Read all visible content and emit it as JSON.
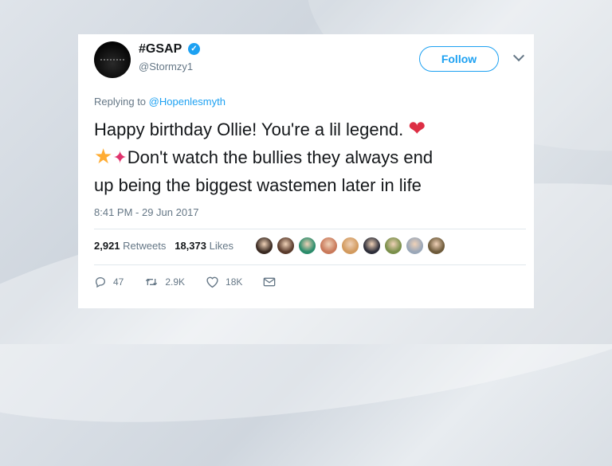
{
  "tweet": {
    "display_name": "#GSAP",
    "handle": "@Stormzy1",
    "follow_label": "Follow",
    "replying_prefix": "Replying to",
    "replying_mention": "@Hopenlesmyth",
    "text_line1": "Happy birthday Ollie! You're a lil legend.",
    "text_line2": "Don't watch the bullies they always end",
    "text_line3": "up being the biggest wastemen later in life",
    "timestamp": "8:41 PM - 29 Jun 2017",
    "retweets_count": "2,921",
    "retweets_label": "Retweets",
    "likes_count": "18,373",
    "likes_label": "Likes",
    "reply_count": "47",
    "retweet_action_count": "2.9K",
    "like_action_count": "18K"
  },
  "icons": {
    "verified": "verified-badge-icon",
    "caret": "chevron-down-icon",
    "reply": "reply-icon",
    "retweet": "retweet-icon",
    "like": "heart-icon",
    "message": "envelope-icon"
  },
  "colors": {
    "accent": "#1da1f2",
    "text": "#14171a",
    "muted": "#657786",
    "heart": "#dd2e44"
  },
  "likers": [
    "#3a2a22",
    "#5a3b2c",
    "#2b8c6b",
    "#c9795a",
    "#d29a5e",
    "#2e2f3a",
    "#7a8f4a",
    "#9aa7b8",
    "#6d5a3a"
  ]
}
